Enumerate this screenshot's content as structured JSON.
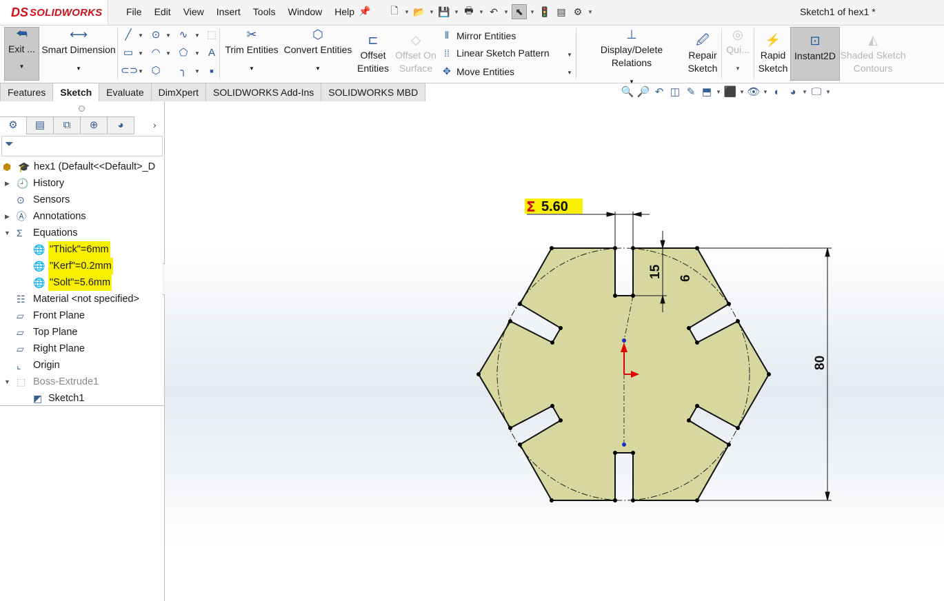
{
  "app": {
    "brand": "SOLIDWORKS",
    "logo_ds": "DS",
    "document_title": "Sketch1 of hex1 *"
  },
  "menu": [
    "File",
    "Edit",
    "View",
    "Insert",
    "Tools",
    "Window",
    "Help"
  ],
  "ribbon": {
    "exit_sketch": "Exit ...",
    "smart_dimension": "Smart Dimension",
    "trim_entities": "Trim Entities",
    "convert_entities": "Convert Entities",
    "offset_entities_1": "Offset",
    "offset_entities_2": "Entities",
    "offset_surface_1": "Offset On",
    "offset_surface_2": "Surface",
    "mirror_entities": "Mirror Entities",
    "linear_pattern": "Linear Sketch Pattern",
    "move_entities": "Move Entities",
    "display_relations": "Display/Delete Relations",
    "repair_sketch_1": "Repair",
    "repair_sketch_2": "Sketch",
    "quick_snaps": "Qui...",
    "rapid_sketch_1": "Rapid",
    "rapid_sketch_2": "Sketch",
    "instant2d": "Instant2D",
    "shaded_contours_1": "Shaded Sketch",
    "shaded_contours_2": "Contours"
  },
  "tabs": [
    "Features",
    "Sketch",
    "Evaluate",
    "DimXpert",
    "SOLIDWORKS Add-Ins",
    "SOLIDWORKS MBD"
  ],
  "active_tab": "Sketch",
  "tree": {
    "part": "hex1  (Default<<Default>_D",
    "history": "History",
    "sensors": "Sensors",
    "annotations": "Annotations",
    "equations": "Equations",
    "eq1": "\"Thick\"=6mm",
    "eq2": "\"Kerf\"=0.2mm",
    "eq3": "\"Solt\"=5.6mm",
    "material": "Material <not specified>",
    "front_plane": "Front Plane",
    "top_plane": "Top Plane",
    "right_plane": "Right Plane",
    "origin": "Origin",
    "boss_extrude": "Boss-Extrude1",
    "sketch": "Sketch1"
  },
  "sketch": {
    "slot_width_dim": "5.60",
    "equation_symbol": "Σ",
    "slot_depth_dim": "15",
    "slot_gap_dim": "6",
    "height_dim": "80"
  },
  "colors": {
    "sketch_fill": "#d6d8a0",
    "highlight": "#f8f000",
    "dim_symbol": "#d0101a"
  }
}
